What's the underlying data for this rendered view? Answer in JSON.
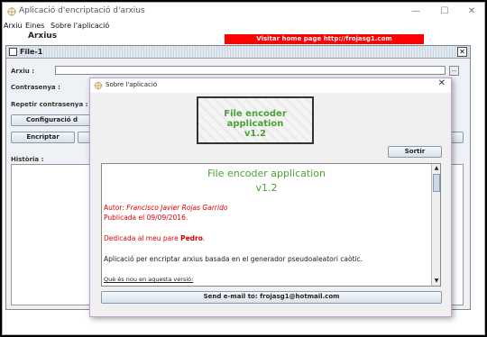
{
  "window": {
    "title": "Aplicació d'encriptació d'arxius",
    "minimize": "—",
    "maximize": "☐",
    "close": "✕"
  },
  "menu": [
    "Arxiu",
    "Eines",
    "Sobre l'aplicació"
  ],
  "app_title": "Arxius",
  "home_banner": "Visitar home page http://frojasg1.com",
  "inner_frame": {
    "title": "File-1",
    "arxiu_label": "Arxiu :",
    "browse_button": "...",
    "password_label": "Contrasenya :",
    "repeat_password_label": "Repetir contrasenya :",
    "config_button": "Configuració d",
    "encrypt_button": "Encriptar",
    "history_label": "Història :"
  },
  "dialog": {
    "title": "Sobre l'aplicació",
    "close": "✕",
    "logo_line1": "File encoder application",
    "logo_line2": "v1.2",
    "exit_button": "Sortir",
    "content": {
      "heading1": "File encoder application",
      "heading2": "v1.2",
      "author_prefix": "Autor: ",
      "author_name": "Francisco Javier Rojas Garrido",
      "published": "Publicada el 09/09/2016.",
      "dedication_prefix": "Dedicada al meu pare ",
      "dedication_name": "Pedro",
      "dedication_suffix": ".",
      "description": "Aplicació per encriptar arxius basada en el generador pseudoaleatori caòtic.",
      "whats_new": "Què és nou en aquesta versió:"
    },
    "send_email_button": "Send e-mail to: frojasg1@hotmail.com"
  }
}
